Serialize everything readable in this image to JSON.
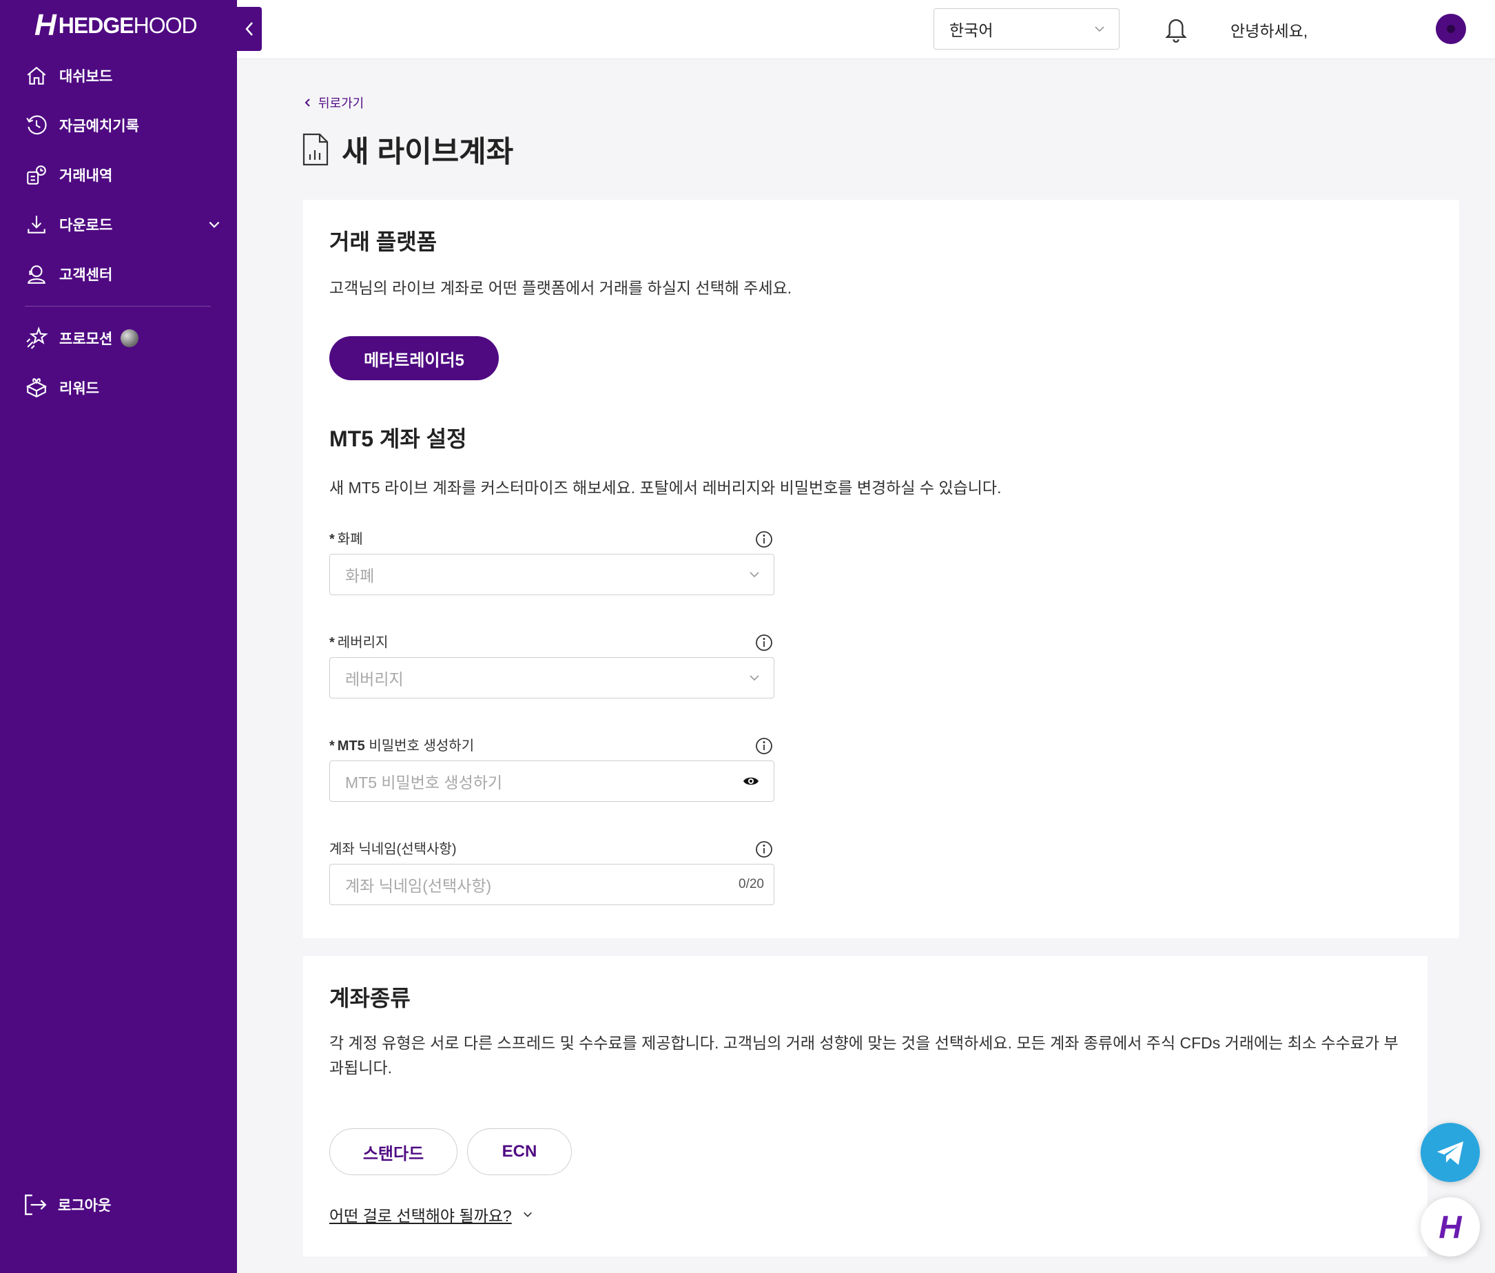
{
  "brand": {
    "logo_bold": "HEDGE",
    "logo_light": "HOOD",
    "logo_mark": "H"
  },
  "sidebar": {
    "items": [
      {
        "label": "대쉬보드",
        "icon": "home-icon"
      },
      {
        "label": "자금예치기록",
        "icon": "history-icon"
      },
      {
        "label": "거래내역",
        "icon": "trade-history-icon"
      },
      {
        "label": "다운로드",
        "icon": "download-icon",
        "expandable": true
      },
      {
        "label": "고객센터",
        "icon": "support-icon"
      }
    ],
    "secondary_items": [
      {
        "label": "프로모션",
        "icon": "star-icon"
      },
      {
        "label": "리워드",
        "icon": "gift-icon"
      }
    ],
    "logout_label": "로그아웃"
  },
  "topbar": {
    "language": "한국어",
    "greeting": "안녕하세요,"
  },
  "main": {
    "back_label": "뒤로가기",
    "page_title": "새 라이브계좌",
    "platform": {
      "title": "거래 플랫폼",
      "description": "고객님의 라이브 계좌로 어떤 플랫폼에서 거래를 하실지 선택해 주세요.",
      "selected_platform": "메타트레이더5"
    },
    "mt5_settings": {
      "title": "MT5 계좌 설정",
      "description": "새 MT5 라이브 계좌를 커스터마이즈 해보세요. 포탈에서 레버리지와 비밀번호를 변경하실 수 있습니다.",
      "fields": {
        "currency": {
          "label": "화폐",
          "placeholder": "화폐",
          "required": "*"
        },
        "leverage": {
          "label": "레버리지",
          "placeholder": "레버리지",
          "required": "*"
        },
        "password": {
          "label_bold": "MT5",
          "label_rest": " 비밀번호 생성하기",
          "placeholder": "MT5 비밀번호 생성하기",
          "required": "*"
        },
        "nickname": {
          "label": "계좌 닉네임(선택사항)",
          "placeholder": "계좌 닉네임(선택사항)",
          "counter": "0/20"
        }
      }
    },
    "account_type": {
      "title": "계좌종류",
      "description": "각 계정 유형은 서로 다른 스프레드 및 수수료를 제공합니다. 고객님의 거래 성향에 맞는 것을 선택하세요. 모든 계좌 종류에서 주식 CFDs 거래에는 최소 수수료가 부과됩니다.",
      "options": [
        "스탠다드",
        "ECN"
      ],
      "help_link": "어떤 걸로 선택해야 될까요?"
    }
  },
  "colors": {
    "brand_purple": "#4f0a82",
    "telegram_blue": "#2aa6df"
  }
}
